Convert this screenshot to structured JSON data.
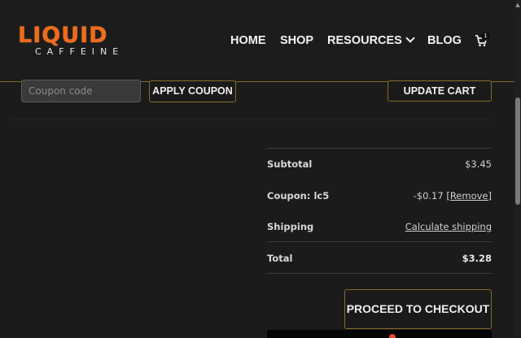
{
  "header": {
    "logo": {
      "main": "LIQUID",
      "sub": "CAFFEINE"
    },
    "nav": [
      {
        "label": "HOME"
      },
      {
        "label": "SHOP"
      },
      {
        "label": "RESOURCES"
      },
      {
        "label": "BLOG"
      }
    ],
    "cart": {
      "count": "1",
      "icon": "cart-icon"
    }
  },
  "coupon": {
    "placeholder": "Coupon code",
    "apply_label": "APPLY COUPON",
    "update_label": "UPDATE CART"
  },
  "totals": {
    "subtotal": {
      "label": "Subtotal",
      "value": "$3.45"
    },
    "coupon": {
      "label": "Coupon: lc5",
      "value": "-$0.17",
      "remove": "[Remove]"
    },
    "shipping": {
      "label": "Shipping",
      "value": "Calculate shipping"
    },
    "total": {
      "label": "Total",
      "value": "$3.28"
    }
  },
  "checkout": {
    "label": "PROCEED TO CHECKOUT"
  },
  "colors": {
    "accent_border": "#8a6a2a",
    "logo_orange": "#f26a1b",
    "background": "#1b1b1b"
  }
}
